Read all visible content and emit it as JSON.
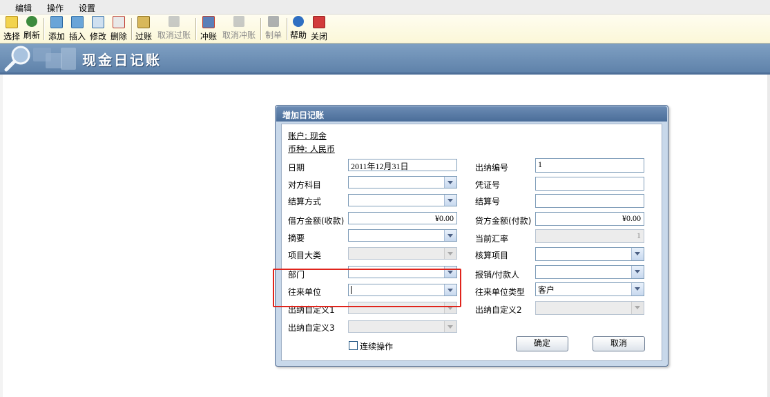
{
  "menu": {
    "edit": "编辑",
    "operate": "操作",
    "settings": "设置"
  },
  "toolbar": {
    "select": "选择",
    "refresh": "刷新",
    "add": "添加",
    "insert": "插入",
    "modify": "修改",
    "delete": "删除",
    "post": "过账",
    "unpost": "取消过账",
    "reverse": "冲账",
    "unreverse": "取消冲账",
    "voucher": "制单",
    "help": "帮助",
    "close": "关闭"
  },
  "banner": {
    "title": "现金日记账"
  },
  "dialog": {
    "title": "增加日记账",
    "account": "账户: 现金",
    "currency": "币种: 人民币",
    "labels": {
      "date": "日期",
      "counter_account": "对方科目",
      "settlement_method": "结算方式",
      "debit_amount": "借方金额(收款)",
      "summary": "摘要",
      "project_category": "项目大类",
      "department": "部门",
      "counterparty": "往来单位",
      "custom1": "出纳自定义1",
      "custom3": "出纳自定义3",
      "cashier_no": "出纳编号",
      "voucher_no": "凭证号",
      "settlement_no": "结算号",
      "credit_amount": "贷方金额(付款)",
      "exchange_rate": "当前汇率",
      "accounting_item": "核算项目",
      "reimburser": "报销/付款人",
      "counterparty_type": "往来单位类型",
      "custom2": "出纳自定义2"
    },
    "values": {
      "date": "2011年12月31日",
      "debit_amount": "¥0.00",
      "cashier_no": "1",
      "credit_amount": "¥0.00",
      "exchange_rate": "1",
      "counterparty_type": "客户"
    },
    "continuous": "连续操作",
    "ok": "确定",
    "cancel": "取消"
  },
  "colors": {
    "banner": "#6a8db6",
    "dialog_title": "#5a7ca6",
    "highlight": "#e0241c",
    "toolbar": "#fcf9e2"
  }
}
